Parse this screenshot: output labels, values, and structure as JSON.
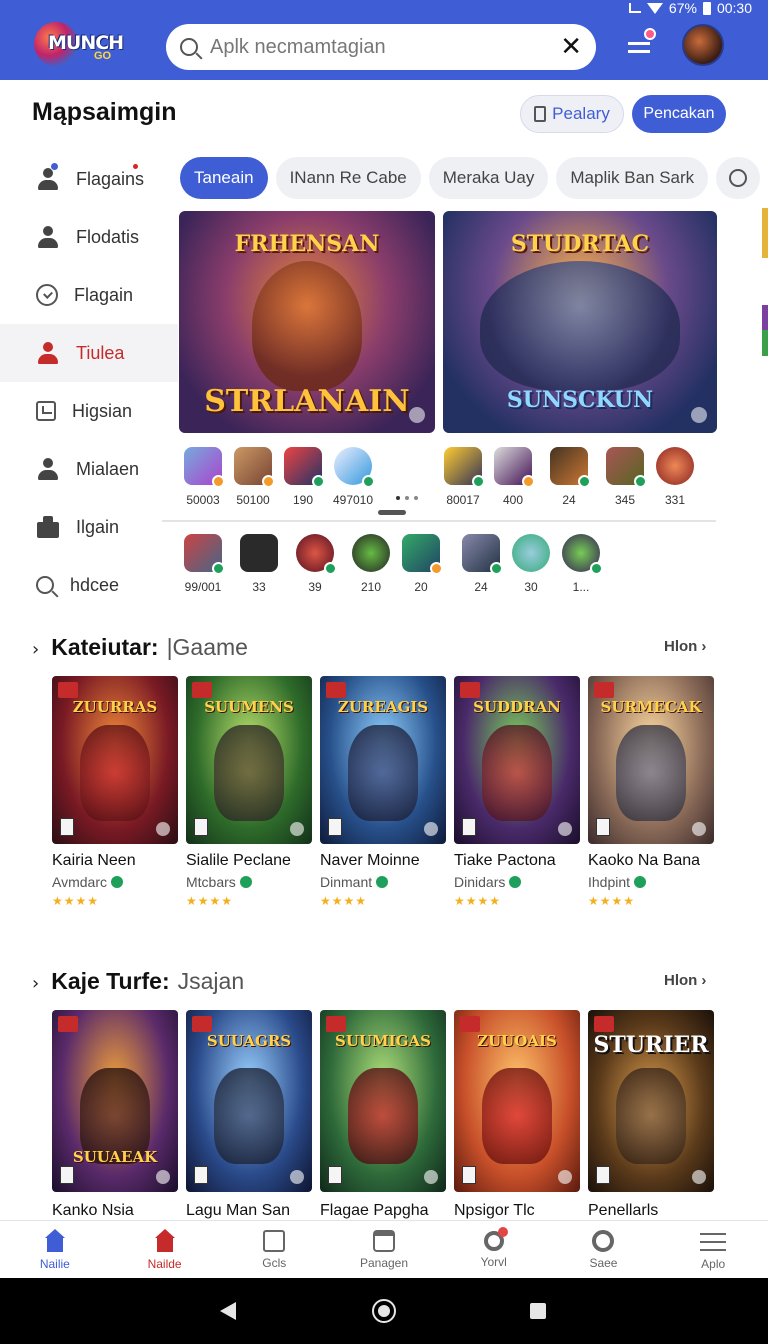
{
  "colors": {
    "primary": "#3f5ed6",
    "active_red": "#c62b2b",
    "verified_green": "#1ea05a",
    "star": "#f2b01e"
  },
  "status_bar": {
    "battery": "67%",
    "time": "00:30"
  },
  "app": {
    "logo_text": "MUNCH",
    "logo_sub": "GO"
  },
  "search": {
    "placeholder": "Aplk necmamtagian",
    "value": "",
    "clear_icon": "close-icon"
  },
  "header": {
    "title": "Mąpsaimgin",
    "outline_button": "Pealary",
    "primary_button": "Pencakan"
  },
  "sidebar": {
    "items": [
      {
        "label": "Flagains",
        "icon": "user-add-icon"
      },
      {
        "label": "Flodatis",
        "icon": "person-icon"
      },
      {
        "label": "Flagain",
        "icon": "clock-icon"
      },
      {
        "label": "Tiulea",
        "icon": "person-active-icon"
      },
      {
        "label": "Higsian",
        "icon": "inbox-icon"
      },
      {
        "label": "Mialaen",
        "icon": "person-icon"
      },
      {
        "label": "Ilgain",
        "icon": "bag-icon"
      },
      {
        "label": "hdcee",
        "icon": "search-icon"
      }
    ]
  },
  "chips": [
    "Taneain",
    "INann Re Cabe",
    "Meraka Uay",
    "Maplik Ban Sark"
  ],
  "banners": [
    {
      "title": "FRHENSAN",
      "bottom": "STRLANAIN"
    },
    {
      "title": "STUDRTAC",
      "bottom": "SUNSCKUN"
    }
  ],
  "icon_row_1": [
    "50003",
    "50100",
    "190",
    "497010",
    "80017",
    "400",
    "24",
    "345",
    "331"
  ],
  "icon_row_2": [
    "99/001",
    "33",
    "39",
    "210",
    "20",
    "24",
    "30",
    "1..."
  ],
  "section1": {
    "title": "Kateiutar:",
    "subtitle": "|Gaame",
    "see_more": "Hlon",
    "cards": [
      {
        "cover": "ZUURRAS",
        "name": "Kairia Neen",
        "dev": "Avmdarc"
      },
      {
        "cover": "SUUMENS",
        "name": "Sialile Peclane",
        "dev": "Mtcbars"
      },
      {
        "cover": "ZUREAGIS",
        "name": "Naver Moinne",
        "dev": "Dinmant"
      },
      {
        "cover": "SUDDRAN",
        "name": "Tiake Pactona",
        "dev": "Dinidars"
      },
      {
        "cover": "SURMECAK",
        "name": "Kaoko Na Bana",
        "dev": "Ihdpint"
      }
    ]
  },
  "section2": {
    "title": "Kaje Turfe:",
    "subtitle": "Jsajan",
    "see_more": "Hlon",
    "cards": [
      {
        "cover": "SUUAEAK",
        "name": "Kanko Nsia"
      },
      {
        "cover": "SUUAGRS",
        "name": "Lagu Man San"
      },
      {
        "cover": "SUUMIGAS",
        "name": "Flagae Papgha"
      },
      {
        "cover": "ZUUOAIS",
        "name": "Npsigor Tlc"
      },
      {
        "cover": "STURIER",
        "name": "Penellarls"
      }
    ]
  },
  "bottom_nav": [
    "Nailie",
    "Nailde",
    "Gcls",
    "Panagen",
    "Yorvl",
    "Saee",
    "Aplo"
  ]
}
